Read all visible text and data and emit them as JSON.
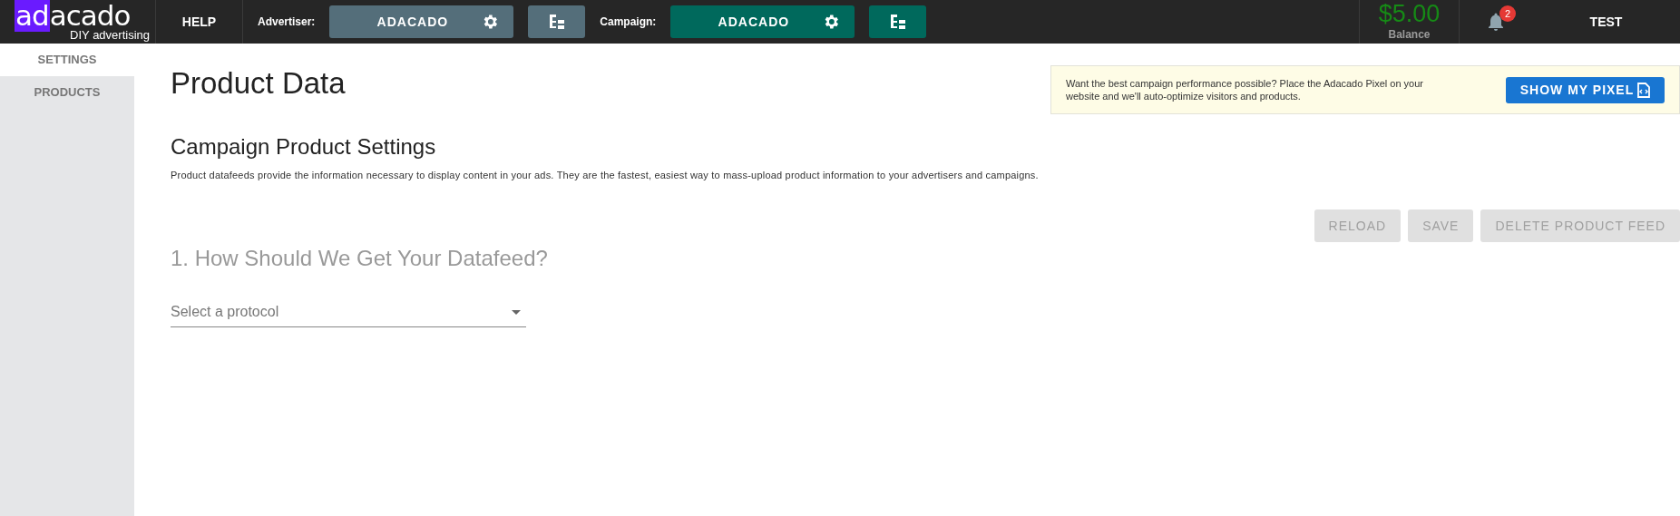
{
  "topbar": {
    "logo": {
      "highlight": "ad",
      "rest": "acado",
      "tagline": "DIY advertising"
    },
    "help": "HELP",
    "selectors": [
      {
        "label": "Advertiser:",
        "value": "ADACADO",
        "color": "#546e7a"
      },
      {
        "label": "Campaign:",
        "value": "ADACADO",
        "color": "#00695c"
      }
    ],
    "balance": {
      "amount": "$5.00",
      "caption": "Balance"
    },
    "notifications": {
      "count": "2"
    },
    "user": "TEST"
  },
  "sidebar": {
    "items": [
      {
        "label": "SETTINGS",
        "selected": true
      },
      {
        "label": "PRODUCTS",
        "selected": false
      }
    ]
  },
  "page": {
    "title": "Product Data",
    "banner": {
      "text": "Want the best campaign performance possible? Place the Adacado Pixel on your website and we'll auto-optimize visitors and products.",
      "button": "SHOW MY PIXEL"
    },
    "section_title": "Campaign Product Settings",
    "description": "Product datafeeds provide the information necessary to display content in your ads. They are the fastest, easiest way to mass-upload product information to your advertisers and campaigns.",
    "actions": [
      {
        "label": "RELOAD",
        "disabled": true
      },
      {
        "label": "SAVE",
        "disabled": true
      },
      {
        "label": "DELETE PRODUCT FEED",
        "disabled": true
      }
    ],
    "step_title": "1. How Should We Get Your Datafeed?",
    "protocol": {
      "placeholder": "Select a protocol"
    }
  }
}
